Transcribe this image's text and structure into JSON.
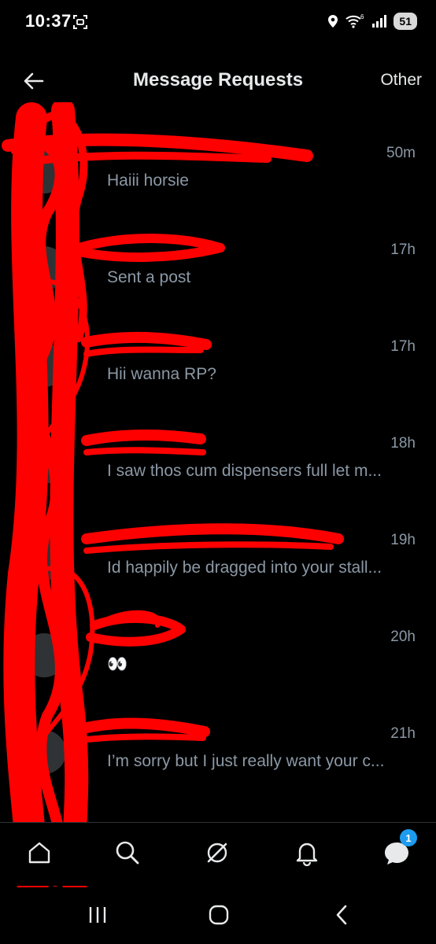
{
  "status_bar": {
    "time": "10:37",
    "signal_type": "6",
    "battery": "51"
  },
  "header": {
    "title": "Message Requests",
    "other_label": "Other"
  },
  "conversations": [
    {
      "time": "50m",
      "preview": "Haiii horsie"
    },
    {
      "time": "17h",
      "preview": "Sent a post"
    },
    {
      "time": "17h",
      "preview": "Hii wanna RP?"
    },
    {
      "time": "18h",
      "preview": "I saw thos cum dispensers full let m..."
    },
    {
      "time": "19h",
      "preview": "Id happily be dragged into your stall..."
    },
    {
      "time": "20h",
      "preview": "👀"
    },
    {
      "time": "21h",
      "preview": "I’m sorry but I just really want your c..."
    }
  ],
  "bottom_nav": {
    "items": [
      "home-icon",
      "search-icon",
      "grok-icon",
      "notifications-icon",
      "messages-icon"
    ],
    "messages_badge": "1"
  },
  "colors": {
    "background": "#000000",
    "text_primary": "#e7e9ea",
    "text_secondary": "#8b98a5",
    "badge": "#1d9bf0",
    "redaction": "#ff0000"
  }
}
